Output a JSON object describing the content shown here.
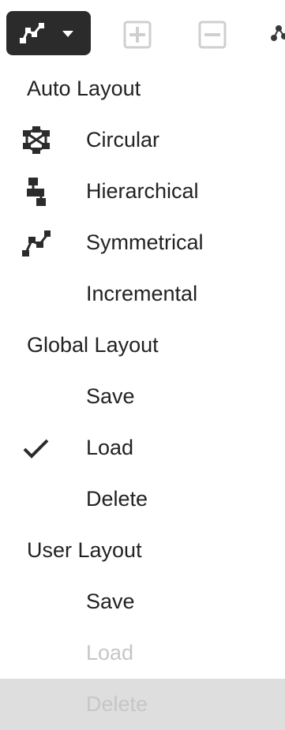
{
  "toolbar": {
    "layout_button_icon": "symmetrical-layout-icon",
    "expand_icon": "expand-icon",
    "collapse_icon": "collapse-icon",
    "more_icon": "network-icon"
  },
  "menu": {
    "auto_layout": {
      "header": "Auto Layout",
      "items": [
        {
          "label": "Circular",
          "icon": "circular-layout-icon"
        },
        {
          "label": "Hierarchical",
          "icon": "hierarchical-layout-icon"
        },
        {
          "label": "Symmetrical",
          "icon": "symmetrical-layout-icon"
        },
        {
          "label": "Incremental",
          "icon": ""
        }
      ]
    },
    "global_layout": {
      "header": "Global Layout",
      "items": [
        {
          "label": "Save"
        },
        {
          "label": "Load",
          "icon": "checkmark-icon"
        },
        {
          "label": "Delete"
        }
      ]
    },
    "user_layout": {
      "header": "User Layout",
      "items": [
        {
          "label": "Save"
        },
        {
          "label": "Load",
          "state": "disabled"
        },
        {
          "label": "Delete",
          "state": "disabled-highlighted"
        }
      ]
    }
  },
  "colors": {
    "button_bg": "#2b2b2b",
    "text": "#222222",
    "disabled_text": "#c6c6c6",
    "highlight_bg": "#dedede"
  }
}
